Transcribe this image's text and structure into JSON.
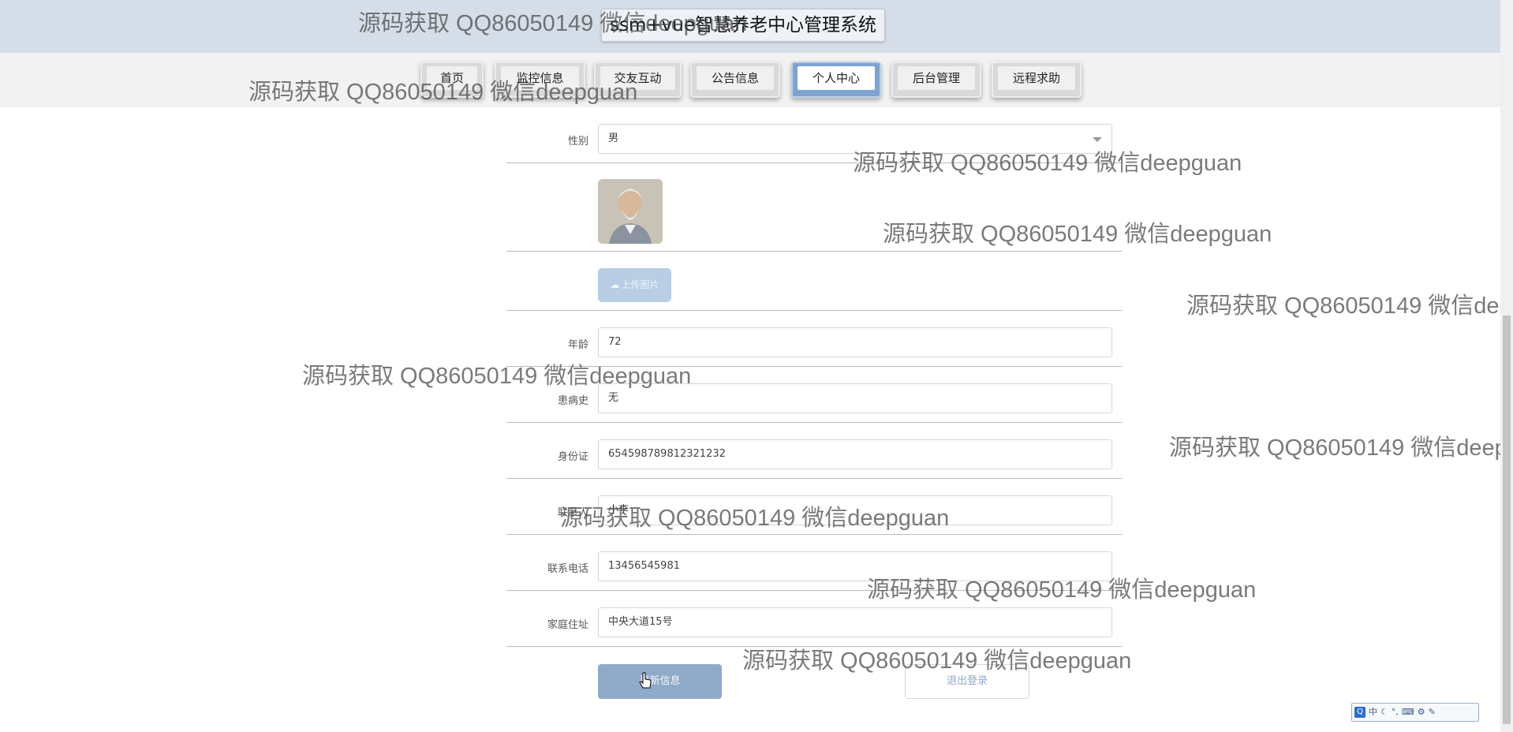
{
  "header": {
    "title": "ssm+vue智慧养老中心管理系统"
  },
  "nav": {
    "items": [
      {
        "label": "首页",
        "active": false
      },
      {
        "label": "监控信息",
        "active": false
      },
      {
        "label": "交友互动",
        "active": false
      },
      {
        "label": "公告信息",
        "active": false
      },
      {
        "label": "个人中心",
        "active": true
      },
      {
        "label": "后台管理",
        "active": false
      },
      {
        "label": "远程求助",
        "active": false
      }
    ]
  },
  "form": {
    "gender": {
      "label": "性别",
      "value": "男"
    },
    "upload_label": "上传图片",
    "age": {
      "label": "年龄",
      "value": "72"
    },
    "medical_history": {
      "label": "患病史",
      "value": "无"
    },
    "id_card": {
      "label": "身份证",
      "value": "654598789812321232"
    },
    "contact_person": {
      "label": "联系人",
      "value": "小李"
    },
    "contact_phone": {
      "label": "联系电话",
      "value": "13456545981"
    },
    "home_address": {
      "label": "家庭住址",
      "value": "中央大道15号"
    },
    "update_button": "更新信息",
    "logout_button": "退出登录"
  },
  "watermark_text": "源码获取 QQ86050149 微信deepguan",
  "ime": {
    "logo": "Q",
    "mode": "中"
  },
  "colors": {
    "header_bg": "#d5dee8",
    "active_tab": "#7ea3cf",
    "primary_button": "#8fa9c9",
    "upload_button": "#b9cde4"
  },
  "icons": [
    "cloud-upload-icon",
    "select-caret-icon",
    "pointer-cursor-icon"
  ]
}
